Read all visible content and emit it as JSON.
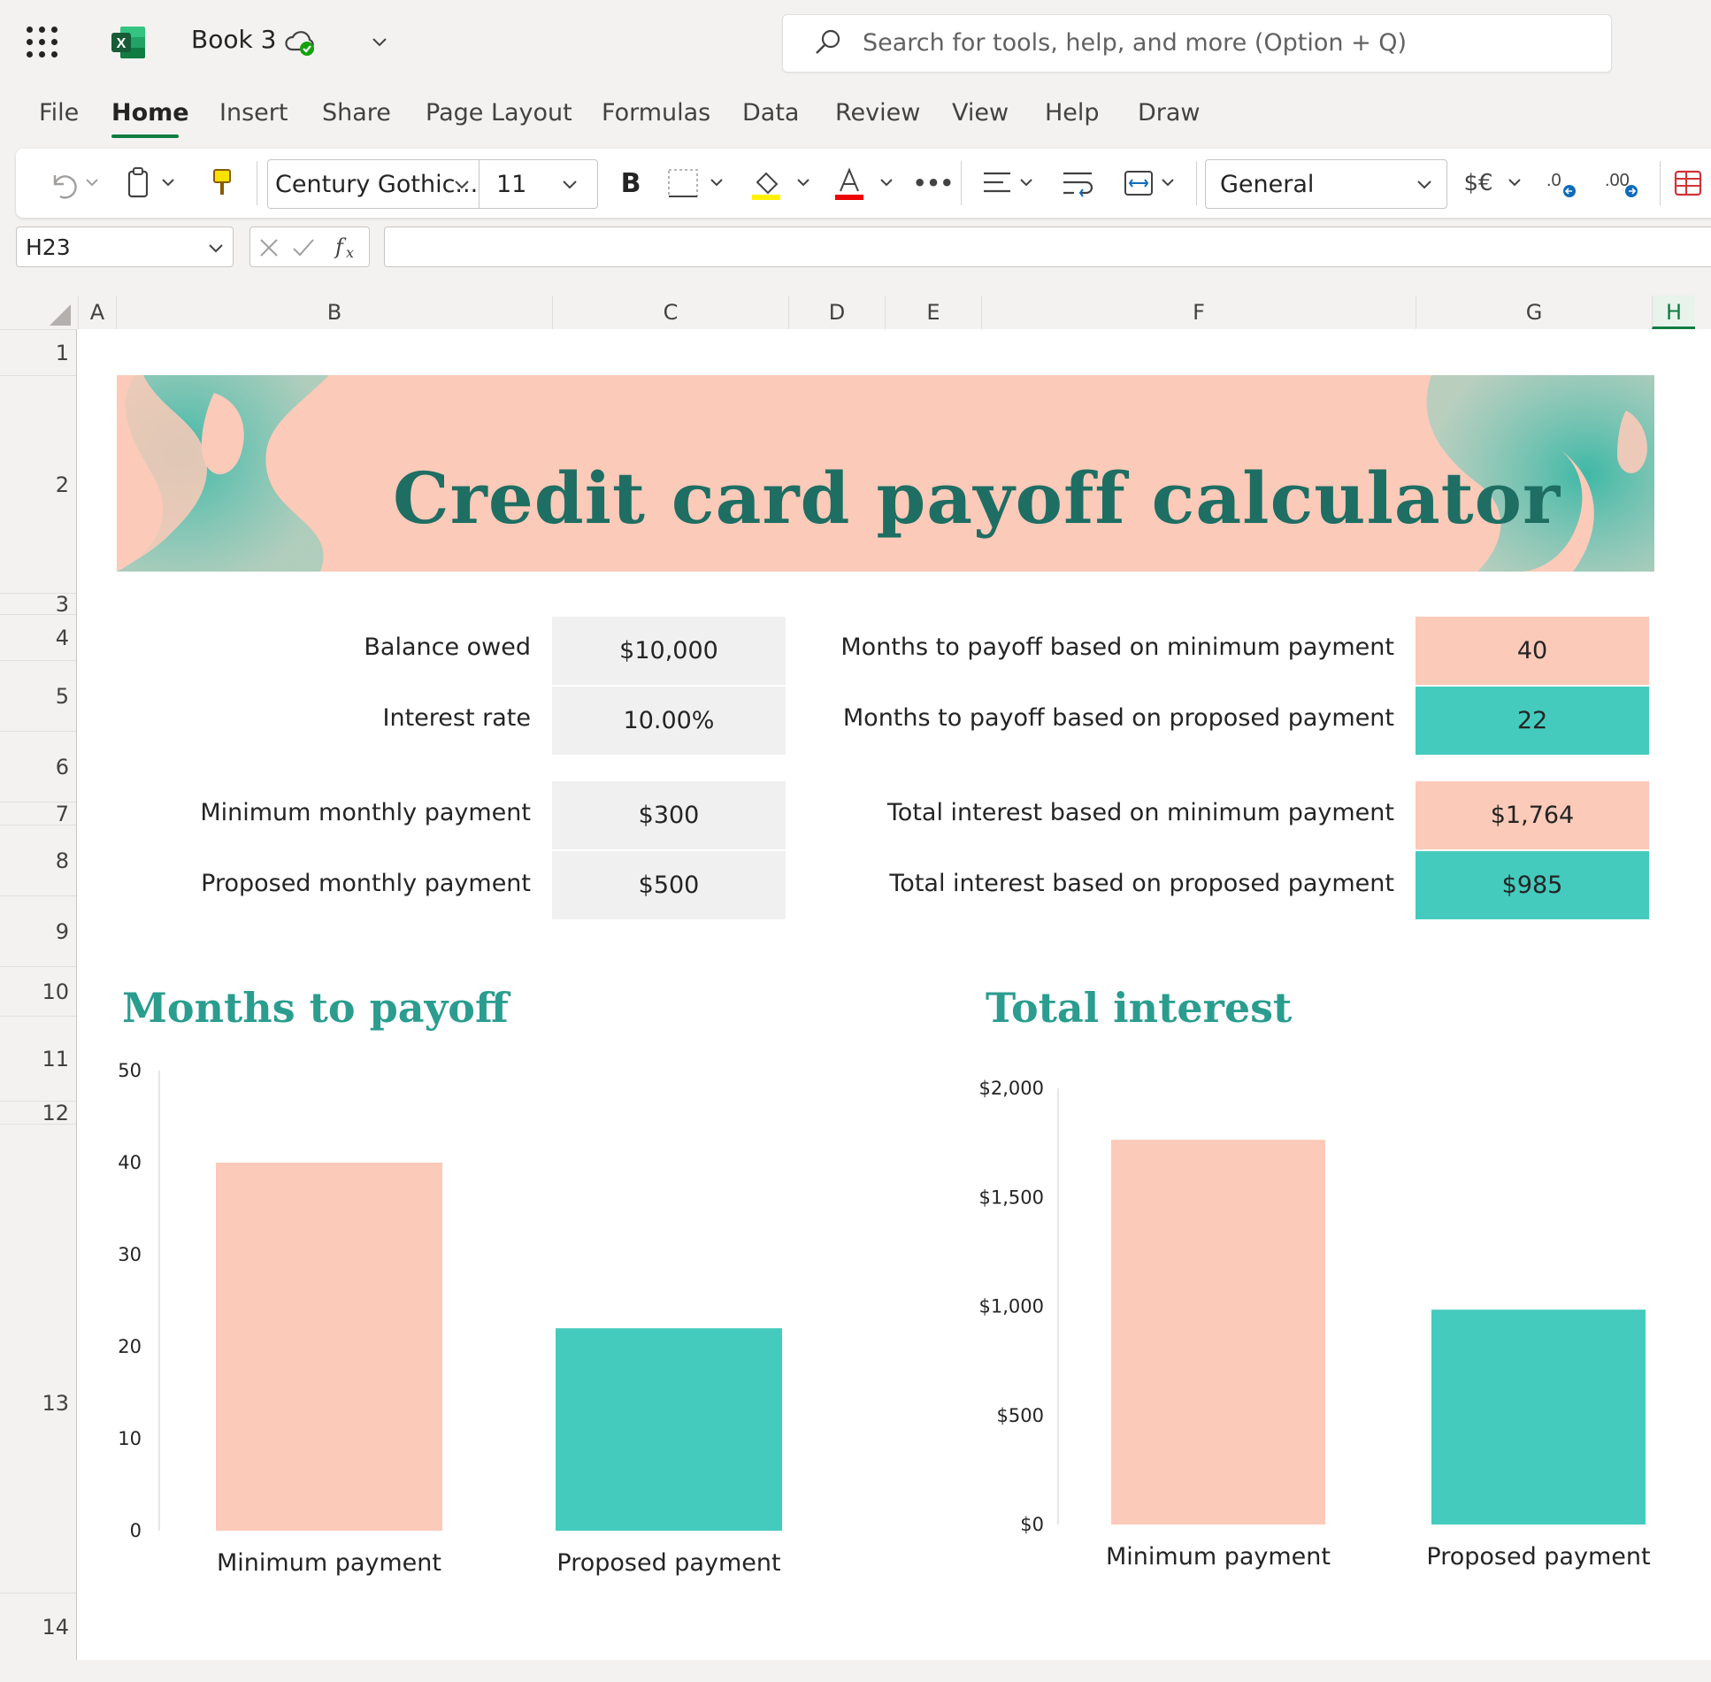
{
  "app": {
    "doc_title": "Book 3",
    "search_placeholder": "Search for tools, help, and more (Option + Q)"
  },
  "menu": [
    "File",
    "Home",
    "Insert",
    "Share",
    "Page Layout",
    "Formulas",
    "Data",
    "Review",
    "View",
    "Help",
    "Draw"
  ],
  "ribbon": {
    "font_name": "Century Gothic...",
    "font_size": "11",
    "bold_label": "B",
    "number_format": "General",
    "currency_label": "$€",
    "more_label": "•••"
  },
  "formula_bar": {
    "name_box": "H23",
    "formula": ""
  },
  "columns": [
    "A",
    "B",
    "C",
    "D",
    "E",
    "F",
    "G",
    "H"
  ],
  "rows": [
    "1",
    "2",
    "3",
    "4",
    "5",
    "6",
    "7",
    "8",
    "9",
    "10",
    "11",
    "12",
    "13",
    "14"
  ],
  "sheet": {
    "title": "Credit card payoff calculator",
    "inputs": [
      {
        "label": "Balance owed",
        "value": "$10,000"
      },
      {
        "label": "Interest rate",
        "value": "10.00%"
      },
      {
        "label": "Minimum monthly payment",
        "value": "$300"
      },
      {
        "label": "Proposed monthly payment",
        "value": "$500"
      }
    ],
    "results": [
      {
        "label": "Months to payoff based on minimum payment",
        "value": "40"
      },
      {
        "label": "Months to payoff based on proposed payment",
        "value": "22"
      },
      {
        "label": "Total interest based on minimum payment",
        "value": "$1,764"
      },
      {
        "label": "Total interest based on proposed payment",
        "value": "$985"
      }
    ]
  },
  "colors": {
    "salmon": "#fbcab9",
    "teal": "#44cbbe",
    "title_green": "#1e6e63",
    "excel_green": "#107c41"
  },
  "chart_data": [
    {
      "type": "bar",
      "title": "Months to payoff",
      "categories": [
        "Minimum payment",
        "Proposed payment"
      ],
      "values": [
        40,
        22
      ],
      "ylim": [
        0,
        50
      ],
      "yticks": [
        "0",
        "10",
        "20",
        "30",
        "40",
        "50"
      ],
      "grid": false,
      "colors": [
        "#fbcab9",
        "#44cbbe"
      ]
    },
    {
      "type": "bar",
      "title": "Total interest",
      "categories": [
        "Minimum payment",
        "Proposed payment"
      ],
      "values": [
        1764,
        985
      ],
      "ylim": [
        0,
        2000
      ],
      "yticks": [
        "$0",
        "$500",
        "$1,000",
        "$1,500",
        "$2,000"
      ],
      "grid": false,
      "colors": [
        "#fbcab9",
        "#44cbbe"
      ]
    }
  ]
}
